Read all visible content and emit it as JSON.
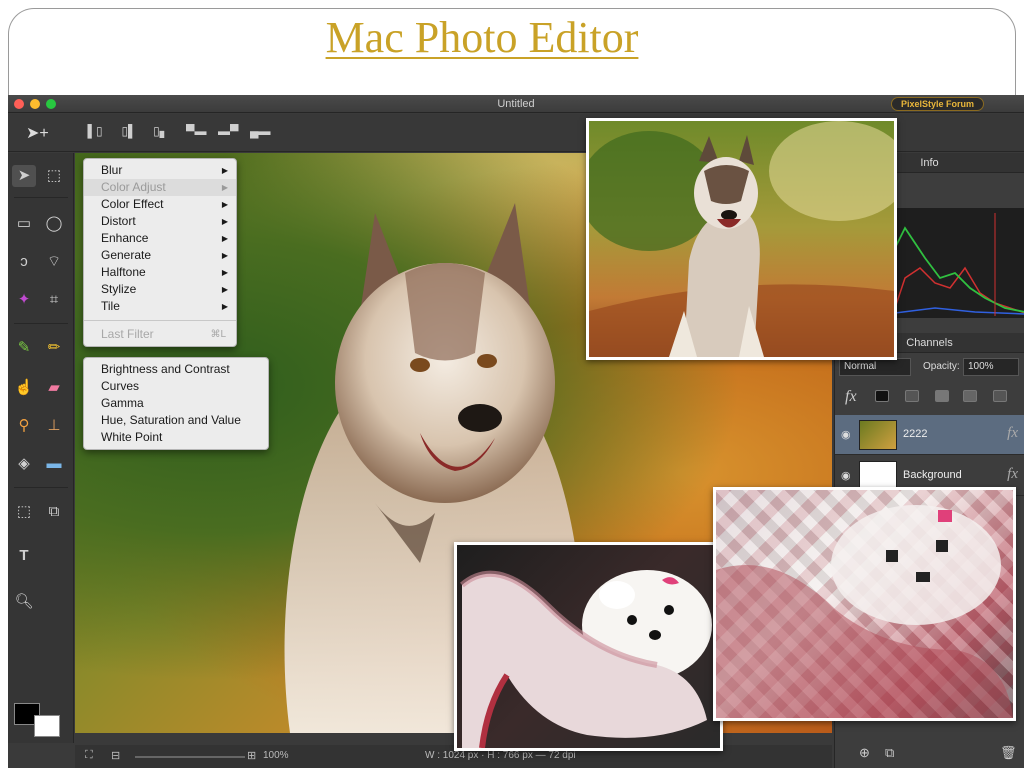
{
  "slide": {
    "title": "Mac Photo Editor"
  },
  "window": {
    "title": "Untitled",
    "forum_button": "PixelStyle Forum"
  },
  "filter_menu": {
    "items": [
      {
        "label": "Blur",
        "has_submenu": true
      },
      {
        "label": "Color Adjust",
        "has_submenu": true,
        "highlighted": true
      },
      {
        "label": "Color Effect",
        "has_submenu": true
      },
      {
        "label": "Distort",
        "has_submenu": true
      },
      {
        "label": "Enhance",
        "has_submenu": true
      },
      {
        "label": "Generate",
        "has_submenu": true
      },
      {
        "label": "Halftone",
        "has_submenu": true
      },
      {
        "label": "Stylize",
        "has_submenu": true
      },
      {
        "label": "Tile",
        "has_submenu": true
      }
    ],
    "last_filter": {
      "label": "Last Filter",
      "shortcut": "⌘L"
    }
  },
  "color_adjust_submenu": {
    "items": [
      "Brightness and Contrast",
      "Curves",
      "Gamma",
      "Hue, Saturation and Value",
      "White Point"
    ]
  },
  "statusbar": {
    "zoom": "100%",
    "dimensions": "W : 1024 px  ·  H : 766 px  —  72 dpi"
  },
  "right_panel": {
    "info_tab": "Info",
    "channels_tab": "Channels",
    "blend_mode": "Normal",
    "opacity_label": "Opacity:",
    "opacity_value": "100%",
    "fx_label": "fx",
    "layers": [
      {
        "name": "2222",
        "selected": true
      },
      {
        "name": "Background",
        "selected": false
      }
    ]
  },
  "colors": {
    "title_gold": "#c9a227",
    "forum_gold": "#e8b63a",
    "selected_layer": "#5c6c80"
  },
  "icons": {
    "toolbar": [
      "move-tool-icon",
      "align-left-icon",
      "align-center-icon",
      "align-right-icon",
      "align-top-icon",
      "align-middle-icon",
      "align-bottom-icon"
    ],
    "toolbox": [
      "move-tool-icon",
      "marquee-icon",
      "rect-select-icon",
      "ellipse-select-icon",
      "lasso-icon",
      "polygon-lasso-icon",
      "magic-wand-icon",
      "crop-icon",
      "brush-icon",
      "pencil-icon",
      "smudge-icon",
      "eraser-icon",
      "eyedropper-icon",
      "stamp-icon",
      "bucket-icon",
      "gradient-icon",
      "transform-icon",
      "vector-icon",
      "text-icon",
      "zoom-icon"
    ]
  }
}
